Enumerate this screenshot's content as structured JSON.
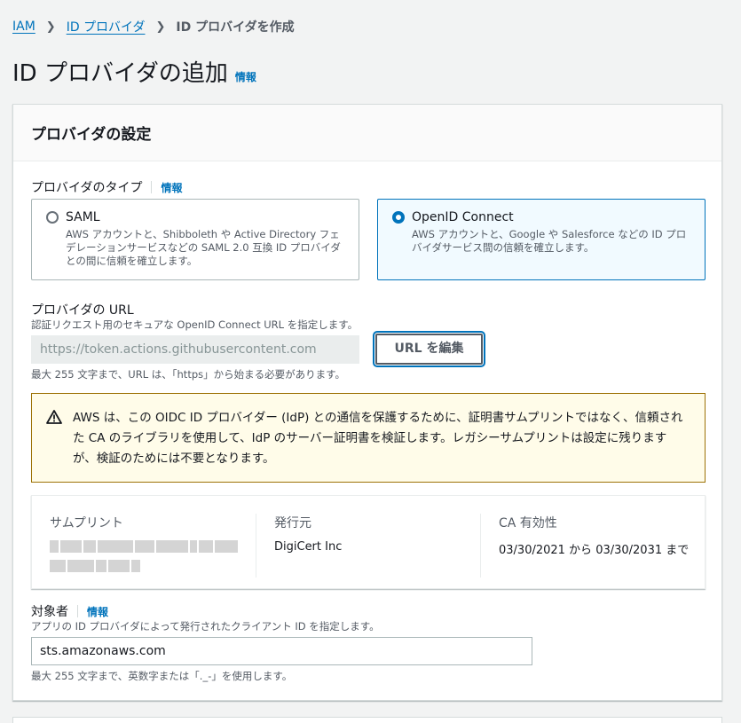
{
  "breadcrumb": {
    "items": [
      "IAM",
      "ID プロバイダ"
    ],
    "current": "ID プロバイダを作成"
  },
  "header": {
    "title": "ID プロバイダの追加",
    "info": "情報"
  },
  "panel": {
    "title": "プロバイダの設定",
    "provider_type": {
      "label": "プロバイダのタイプ",
      "info": "情報",
      "options": [
        {
          "title": "SAML",
          "desc": "AWS アカウントと、Shibboleth や Active Directory フェデレーションサービスなどの SAML 2.0 互換 ID プロバイダとの間に信頼を確立します。",
          "selected": false
        },
        {
          "title": "OpenID Connect",
          "desc": "AWS アカウントと、Google や Salesforce などの ID プロバイダサービス間の信頼を確立します。",
          "selected": true
        }
      ]
    },
    "url": {
      "label": "プロバイダの URL",
      "description": "認証リクエスト用のセキュアな OpenID Connect URL を指定します。",
      "value": "https://token.actions.githubusercontent.com",
      "edit_button": "URL を編集",
      "constraint": "最大 255 文字まで、URL は、「https」から始まる必要があります。"
    },
    "warning": {
      "text": "AWS は、この OIDC ID プロバイダー (IdP) との通信を保護するために、証明書サムプリントではなく、信頼された CA のライブラリを使用して、IdP のサーバー証明書を検証します。レガシーサムプリントは設定に残りますが、検証のためには不要となります。"
    },
    "certificate": {
      "thumbprint_label": "サムプリント",
      "issuer_label": "発行元",
      "issuer_value": "DigiCert Inc",
      "validity_label": "CA 有効性",
      "validity_value": "03/30/2021 から 03/30/2031 まで"
    },
    "audience": {
      "label": "対象者",
      "info": "情報",
      "description": "アプリの ID プロバイダによって発行されたクライアント ID を指定します。",
      "value": "sts.amazonaws.com",
      "constraint": "最大 255 文字まで、英数字または「._-」を使用します。"
    }
  },
  "colors": {
    "accent": "#0073bb",
    "warning_bg": "#fffce9",
    "warning_border": "#9d7206"
  }
}
